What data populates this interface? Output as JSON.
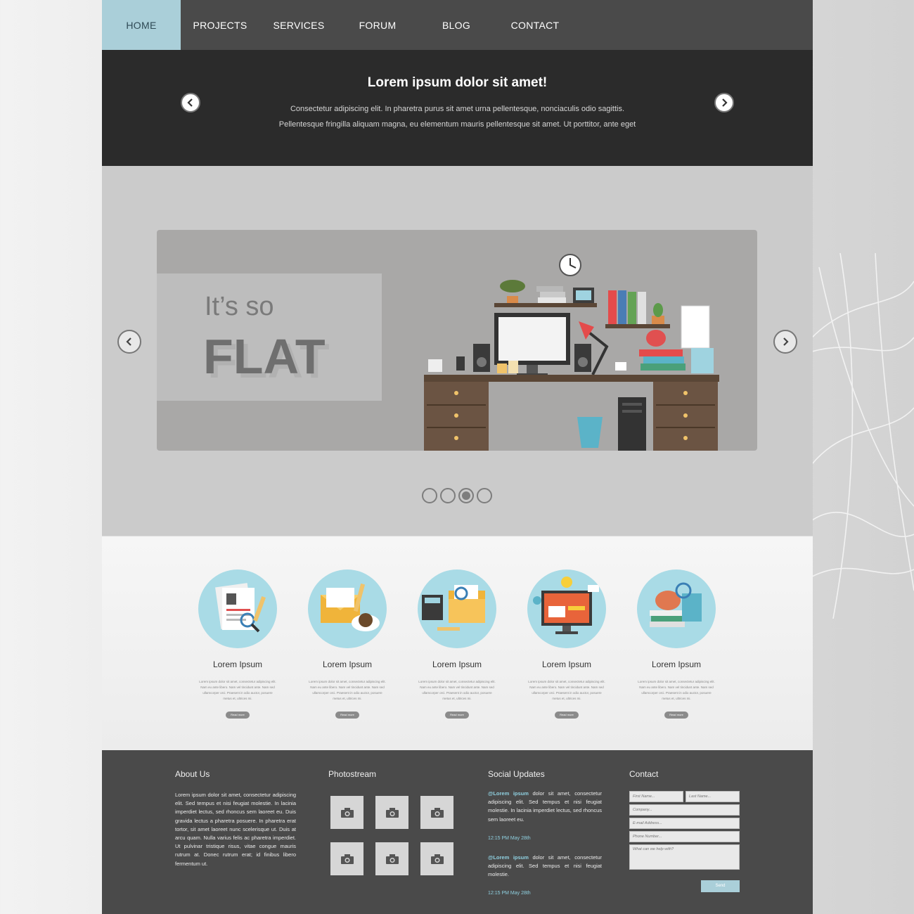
{
  "nav": {
    "items": [
      {
        "label": "HOME",
        "active": true
      },
      {
        "label": "PROJECTS",
        "active": false
      },
      {
        "label": "SERVICES",
        "active": false
      },
      {
        "label": "FORUM",
        "active": false
      },
      {
        "label": "BLOG",
        "active": false
      },
      {
        "label": "CONTACT",
        "active": false
      }
    ]
  },
  "hero": {
    "title": "Lorem ipsum dolor sit amet!",
    "line1": "Consectetur adipiscing elit. In pharetra purus sit amet urna pellentesque, nonciaculis odio sagittis.",
    "line2": "Pellentesque fringilla aliquam magna, eu elementum mauris pellentesque sit amet. Ut porttitor, ante eget"
  },
  "slider": {
    "small_text": "It’s so",
    "big_text": "FLAT",
    "dots": 4,
    "active_dot_index": 2
  },
  "features": [
    {
      "title": "Lorem Ipsum",
      "icon": "document-search-icon",
      "button": "Read more",
      "desc": "Lorem ipsum dolor sit amet, consectetur adipiscing elit. Nam eu ante libero. Nam vel tincidunt ante. Nam sed ullamcorper orci. Praesent in odio auctor, posuere metus et, ultrices mi."
    },
    {
      "title": "Lorem Ipsum",
      "icon": "mail-coffee-icon",
      "button": "Read more",
      "desc": "Lorem ipsum dolor sit amet, consectetur adipiscing elit. Nam eu ante libero. Nam vel tincidunt ante. Nam sed ullamcorper orci. Praesent in odio auctor, posuere metus et, ultrices mi."
    },
    {
      "title": "Lorem Ipsum",
      "icon": "folder-calculator-icon",
      "button": "Read more",
      "desc": "Lorem ipsum dolor sit amet, consectetur adipiscing elit. Nam eu ante libero. Nam vel tincidunt ante. Nam sed ullamcorper orci. Praesent in odio auctor, posuere metus et, ultrices mi."
    },
    {
      "title": "Lorem Ipsum",
      "icon": "monitor-idea-icon",
      "button": "Read more",
      "desc": "Lorem ipsum dolor sit amet, consectetur adipiscing elit. Nam eu ante libero. Nam vel tincidunt ante. Nam sed ullamcorper orci. Praesent in odio auctor, posuere metus et, ultrices mi."
    },
    {
      "title": "Lorem Ipsum",
      "icon": "piggy-bank-books-icon",
      "button": "Read more",
      "desc": "Lorem ipsum dolor sit amet, consectetur adipiscing elit. Nam eu ante libero. Nam vel tincidunt ante. Nam sed ullamcorper orci. Praesent in odio auctor, posuere metus et, ultrices mi."
    }
  ],
  "footer": {
    "about": {
      "heading": "About Us",
      "text": "Lorem ipsum dolor sit amet, consectetur adipiscing elit. Sed tempus et nisi feugiat molestie. In lacinia imperdiet lectus, sed rhoncus sem laoreet eu. Duis gravida lectus a pharetra posuere. In pharetra erat tortor, sit amet laoreet nunc scelerisque ut. Duis at arcu quam. Nulla varius felis ac pharetra imperdiet. Ut pulvinar tristique risus, vitae congue mauris rutrum at. Donec rutrum erat; id finibus libero fermentum ut."
    },
    "photostream": {
      "heading": "Photostream",
      "count": 6
    },
    "social": {
      "heading": "Social Updates",
      "posts": [
        {
          "handle": "@Lorem ipsum",
          "text": " dolor sit amet, consectetur adipiscing elit. Sed tempus et nisi feugiat molestie. In lacinia imperdiet lectus, sed rhoncus sem laoreet eu.",
          "time": "12:15 PM May 28th"
        },
        {
          "handle": "@Lorem ipsum",
          "text": " dolor sit amet, consectetur adipiscing elit. Sed tempus et nisi feugiat molestie.",
          "time": "12:15 PM May 28th"
        }
      ]
    },
    "contact": {
      "heading": "Contact",
      "first_name": "First Name...",
      "last_name": "Last Name...",
      "company": "Company...",
      "email": "E-mail Address...",
      "phone": "Phone Number...",
      "message": "What can we help with?",
      "send": "Send"
    }
  },
  "colors": {
    "nav_bg": "#4a4a4a",
    "nav_active": "#aacfd9",
    "hero_bg": "#2b2b2b",
    "slider_bg": "#cbcbcb",
    "feature_circle": "#a9dbe6",
    "footer_bg": "#4a4a4a",
    "accent_link": "#8fd0e0"
  }
}
